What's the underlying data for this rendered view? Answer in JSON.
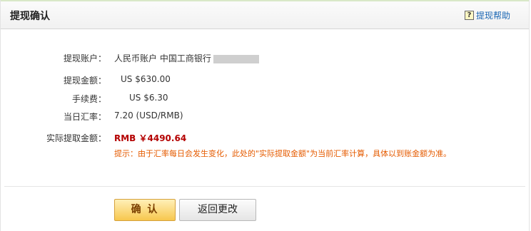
{
  "header": {
    "title": "提现确认",
    "help_label": "提现帮助"
  },
  "details": {
    "account": {
      "label": "提现账户：",
      "value": "人民币账户 中国工商银行"
    },
    "amount": {
      "label": "提现金额：",
      "value": "US $630.00"
    },
    "fee": {
      "label": "手续费：",
      "value": "US $6.30"
    },
    "rate": {
      "label": "当日汇率：",
      "value": "7.20 (USD/RMB)"
    },
    "actual": {
      "label": "实际提取金额：",
      "value": "RMB ￥4490.64"
    }
  },
  "notice": "提示：由于汇率每日会发生变化，此处的\"实际提取金额\"为当前汇率计算，具体以到账金额为准。",
  "buttons": {
    "confirm": "确 认",
    "back": "返回更改"
  }
}
